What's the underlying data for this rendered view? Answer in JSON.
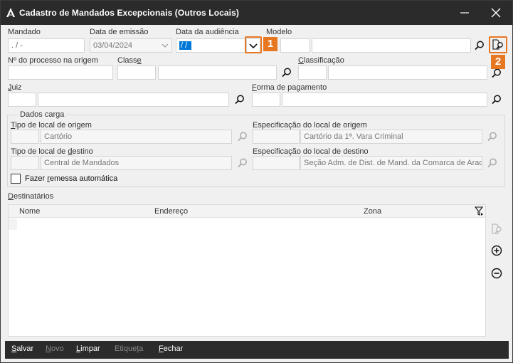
{
  "window": {
    "title": "Cadastro de Mandados Excepcionais (Outros Locais)"
  },
  "fields": {
    "mandado": {
      "label": "Mandado",
      "value": " .  /   -"
    },
    "data_emissao": {
      "label": "Data de emissão",
      "value": "03/04/2024"
    },
    "data_audiencia": {
      "label": "Data da audiência",
      "value": " / /"
    },
    "modelo": {
      "label": "Modelo",
      "code": "",
      "value": ""
    },
    "processo_origem": {
      "label": "Nº do processo na origem",
      "value": ""
    },
    "classe": {
      "label_pre": "Class",
      "label_ul": "e",
      "code": "",
      "value": ""
    },
    "classificacao": {
      "label_ul": "C",
      "label_post": "lassificação",
      "code": "",
      "value": ""
    },
    "juiz": {
      "label_ul": "J",
      "label_post": "uiz",
      "code": "",
      "value": ""
    },
    "forma_pagamento": {
      "label_ul": "F",
      "label_post": "orma de pagamento",
      "code": "",
      "value": ""
    }
  },
  "dados_carga": {
    "title": "Dados carga",
    "tipo_origem": {
      "label_ul": "T",
      "label_post": "ipo de local de origem",
      "code": "",
      "value": "Cartório"
    },
    "espec_origem": {
      "label": "Especificação do local de origem",
      "code": "",
      "value": "Cartório da 1ª. Vara Criminal"
    },
    "tipo_destino": {
      "label_pre": "Tipo de local de ",
      "label_ul": "d",
      "label_post": "estino",
      "code": "",
      "value": "Central de Mandados"
    },
    "espec_destino": {
      "label": "Especificação do local de destino",
      "code": "",
      "value": "Seção Adm. de Dist. de Mand. da Comarca de Arac"
    },
    "remessa": {
      "label_pre": "Fazer ",
      "label_ul": "r",
      "label_post": "emessa automática",
      "checked": false
    }
  },
  "destinatarios": {
    "label_ul": "D",
    "label_post": "estinatários",
    "columns": [
      "Nome",
      "Endereço",
      "Zona"
    ],
    "rows": []
  },
  "footer": {
    "salvar": {
      "ul": "S",
      "rest": "alvar"
    },
    "novo": {
      "ul": "N",
      "rest": "ovo"
    },
    "limpar": {
      "ul": "L",
      "rest": "impar"
    },
    "etiqueta": {
      "pre": "Etique",
      "ul": "t",
      "rest": "a"
    },
    "fechar": {
      "ul": "F",
      "rest": "echar"
    }
  },
  "callouts": {
    "one": "1",
    "two": "2"
  },
  "colors": {
    "accent": "#e87722",
    "titlebar": "#2b2b2b",
    "selection": "#0078d7"
  }
}
